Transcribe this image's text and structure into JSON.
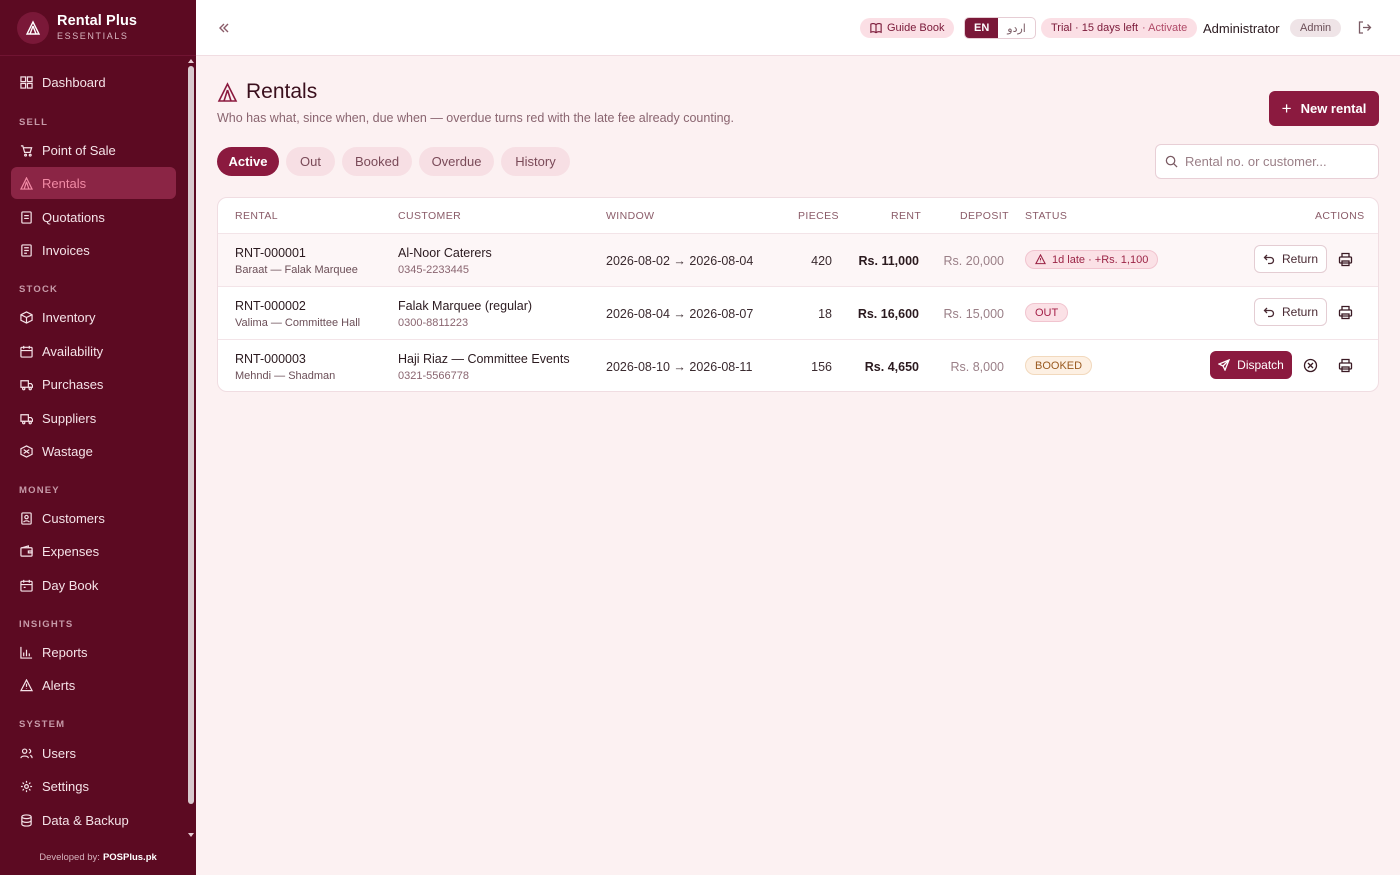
{
  "brand": {
    "name": "Rental Plus",
    "sub": "ESSENTIALS"
  },
  "sidebar": {
    "items": [
      {
        "label": "Dashboard",
        "icon": "dashboard-icon"
      },
      {
        "section": "SELL"
      },
      {
        "label": "Point of Sale",
        "icon": "cart-icon"
      },
      {
        "label": "Rentals",
        "icon": "tent-icon",
        "active": true
      },
      {
        "label": "Quotations",
        "icon": "quote-icon"
      },
      {
        "label": "Invoices",
        "icon": "invoice-icon"
      },
      {
        "section": "STOCK"
      },
      {
        "label": "Inventory",
        "icon": "box-icon"
      },
      {
        "label": "Availability",
        "icon": "calendar-icon"
      },
      {
        "label": "Purchases",
        "icon": "truck-icon"
      },
      {
        "label": "Suppliers",
        "icon": "supplier-icon"
      },
      {
        "label": "Wastage",
        "icon": "wastage-icon"
      },
      {
        "section": "MONEY"
      },
      {
        "label": "Customers",
        "icon": "contacts-icon"
      },
      {
        "label": "Expenses",
        "icon": "wallet-icon"
      },
      {
        "label": "Day Book",
        "icon": "daybook-icon"
      },
      {
        "section": "INSIGHTS"
      },
      {
        "label": "Reports",
        "icon": "chart-icon"
      },
      {
        "label": "Alerts",
        "icon": "alert-icon"
      },
      {
        "section": "SYSTEM"
      },
      {
        "label": "Users",
        "icon": "users-icon"
      },
      {
        "label": "Settings",
        "icon": "gear-icon"
      },
      {
        "label": "Data & Backup",
        "icon": "database-icon"
      }
    ],
    "footer_prefix": "Developed by:",
    "footer_brand": "POSPlus.pk"
  },
  "topbar": {
    "guide": "Guide Book",
    "lang_en": "EN",
    "lang_ur": "اردو",
    "trial": "Trial · 15 days left",
    "trial_action": "· Activate",
    "user_name": "Administrator",
    "user_role": "Admin"
  },
  "page": {
    "title": "Rentals",
    "subtitle": "Who has what, since when, due when — overdue turns red with the late fee already counting.",
    "new_button": "New rental",
    "search_placeholder": "Rental no. or customer...",
    "tabs": [
      "Active",
      "Out",
      "Booked",
      "Overdue",
      "History"
    ],
    "active_tab": "Active"
  },
  "table": {
    "headers": {
      "rental": "RENTAL",
      "customer": "CUSTOMER",
      "window": "WINDOW",
      "pieces": "PIECES",
      "rent": "RENT",
      "deposit": "DEPOSIT",
      "status": "STATUS",
      "actions": "ACTIONS"
    },
    "rows": [
      {
        "id": "RNT-000001",
        "event": "Baraat — Falak Marquee",
        "customer": "Al-Noor Caterers",
        "phone": "0345-2233445",
        "window": "2026-08-02 → 2026-08-04",
        "pieces": "420",
        "rent": "Rs. 11,000",
        "deposit": "Rs. 20,000",
        "status": "1d late · +Rs. 1,100",
        "status_kind": "late",
        "action": "Return"
      },
      {
        "id": "RNT-000002",
        "event": "Valima — Committee Hall",
        "customer": "Falak Marquee (regular)",
        "phone": "0300-8811223",
        "window": "2026-08-04 → 2026-08-07",
        "pieces": "18",
        "rent": "Rs. 16,600",
        "deposit": "Rs. 15,000",
        "status": "OUT",
        "status_kind": "out",
        "action": "Return"
      },
      {
        "id": "RNT-000003",
        "event": "Mehndi — Shadman",
        "customer": "Haji Riaz — Committee Events",
        "phone": "0321-5566778",
        "window": "2026-08-10 → 2026-08-11",
        "pieces": "156",
        "rent": "Rs. 4,650",
        "deposit": "Rs. 8,000",
        "status": "BOOKED",
        "status_kind": "booked",
        "action": "Dispatch"
      }
    ]
  }
}
